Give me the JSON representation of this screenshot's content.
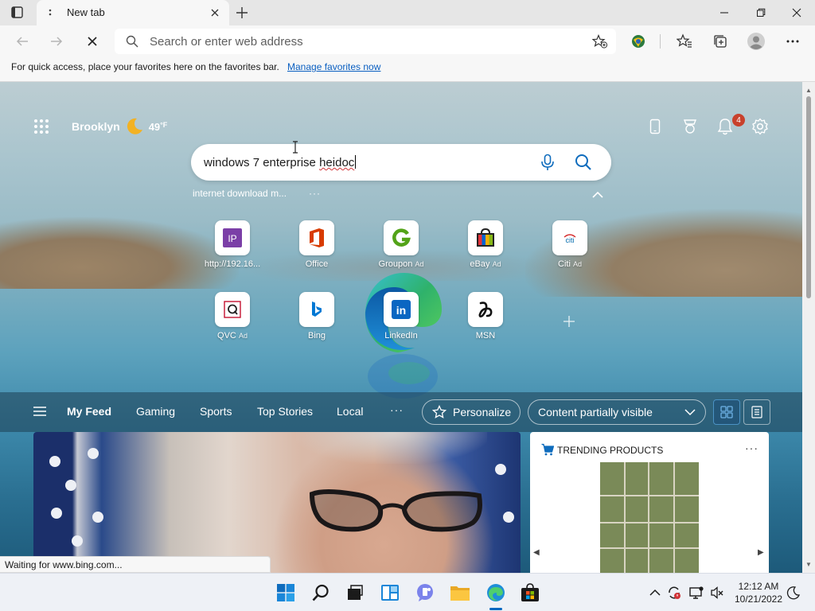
{
  "browser": {
    "tab_title": "New tab",
    "address_placeholder": "Search or enter web address"
  },
  "favorites_bar": {
    "message": "For quick access, place your favorites here on the favorites bar.",
    "link": "Manage favorites now"
  },
  "newtab": {
    "weather": {
      "city": "Brooklyn",
      "temp": "49",
      "unit": "°F"
    },
    "notification_count": "4",
    "search": {
      "query_plain": "windows 7 enterprise ",
      "query_misspelled": "heidoc"
    },
    "suggestion": "internet download m...",
    "suggestion_more": "···",
    "tiles": [
      {
        "label": "http://192.16...",
        "ad": "",
        "icon": "ip-icon",
        "color": "#7b3fa7"
      },
      {
        "label": "Office",
        "ad": "",
        "icon": "office-icon",
        "color": "#d83b01"
      },
      {
        "label": "Groupon",
        "ad": "Ad",
        "icon": "groupon-icon",
        "color": "#53a318"
      },
      {
        "label": "eBay",
        "ad": "Ad",
        "icon": "ebay-icon",
        "color": "#e53238"
      },
      {
        "label": "Citi",
        "ad": "Ad",
        "icon": "citi-icon",
        "color": "#056dae"
      },
      {
        "label": "QVC",
        "ad": "Ad",
        "icon": "qvc-icon",
        "color": "#c41230"
      },
      {
        "label": "Bing",
        "ad": "",
        "icon": "bing-icon",
        "color": "#0078d4"
      },
      {
        "label": "LinkedIn",
        "ad": "",
        "icon": "linkedin-icon",
        "color": "#0a66c2"
      },
      {
        "label": "MSN",
        "ad": "",
        "icon": "msn-icon",
        "color": "#000000"
      }
    ]
  },
  "feed": {
    "tabs": [
      "My Feed",
      "Gaming",
      "Sports",
      "Top Stories",
      "Local"
    ],
    "more": "···",
    "personalize": "Personalize",
    "content_select": "Content partially visible",
    "trending_title": "TRENDING PRODUCTS",
    "trending_more": "···"
  },
  "status": "Waiting for www.bing.com...",
  "taskbar": {
    "time": "12:12 AM",
    "date": "10/21/2022"
  }
}
